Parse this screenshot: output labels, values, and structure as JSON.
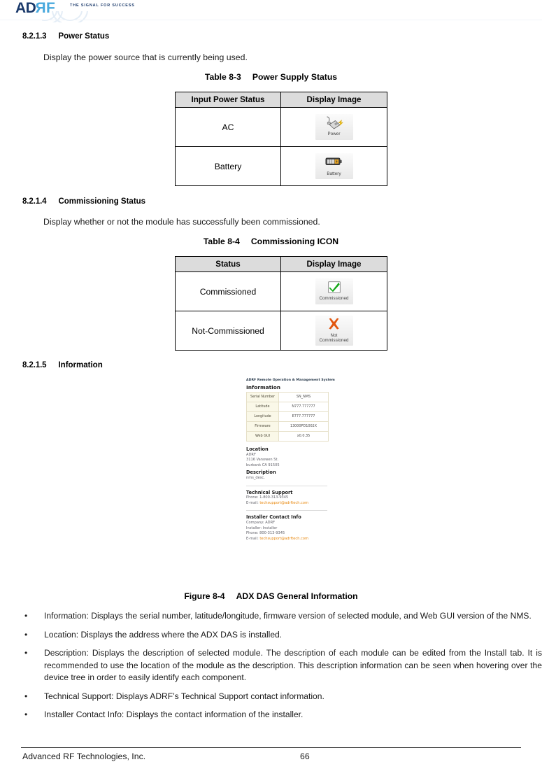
{
  "header": {
    "logo_ad": "AD",
    "logo_r": "R",
    "logo_f": "F",
    "tagline": "THE SIGNAL FOR SUCCESS",
    "brand_navy": "#1b3a6b",
    "brand_cyan": "#49a9dd"
  },
  "sections": [
    {
      "number": "8.2.1.3",
      "title": "Power Status"
    },
    {
      "number": "8.2.1.4",
      "title": "Commissioning Status"
    },
    {
      "number": "8.2.1.5",
      "title": "Information"
    }
  ],
  "paragraphs": {
    "power_status": "Display the power source that is currently being used.",
    "commissioning_status": "Display whether or not the module has successfully been commissioned."
  },
  "table_8_3": {
    "caption_number": "Table 8-3",
    "caption_title": "Power Supply Status",
    "headers": [
      "Input Power Status",
      "Display Image"
    ],
    "rows": [
      {
        "status": "AC",
        "icon_name": "power-plug-icon",
        "icon_caption": "Power"
      },
      {
        "status": "Battery",
        "icon_name": "battery-icon",
        "icon_caption": "Battery"
      }
    ]
  },
  "table_8_4": {
    "caption_number": "Table 8-4",
    "caption_title": "Commissioning ICON",
    "headers": [
      "Status",
      "Display Image"
    ],
    "rows": [
      {
        "status": "Commissioned",
        "icon_name": "green-check-icon",
        "icon_caption": "Commissioned"
      },
      {
        "status": "Not-Commissioned",
        "icon_name": "orange-x-icon",
        "icon_caption_line1": "Not",
        "icon_caption_line2": "Commissioned"
      }
    ]
  },
  "figure": {
    "caption_number": "Figure 8-4",
    "caption_title": "ADX DAS General Information",
    "app_title": "ADRF Remote Operation & Management System",
    "information_heading": "Information",
    "info_rows": [
      {
        "key": "Serial Number",
        "value": "SN_NMS"
      },
      {
        "key": "Latitude",
        "value": "N777.777777"
      },
      {
        "key": "Longitude",
        "value": "E777.777777"
      },
      {
        "key": "Firmware",
        "value": "13000PD1002X"
      },
      {
        "key": "Web GUI",
        "value": "x0.0.35"
      }
    ],
    "location": {
      "heading": "Location",
      "lines": [
        "ADRF",
        "3116 Vanowen St.",
        "burbank CA 91505"
      ]
    },
    "description": {
      "heading": "Description",
      "lines": [
        "nms_desc."
      ]
    },
    "technical_support": {
      "heading": "Technical Support",
      "phone_label": "Phone: 1-800-313-9345",
      "email_label": "E-mail: ",
      "email_value": "techsupport@adrftech.com"
    },
    "installer_contact": {
      "heading": "Installer Contact Info",
      "company": "Company: ADRF",
      "installer": "Installer: Installer",
      "phone": "Phone: 800-313-9345",
      "email_label": "E-mail: ",
      "email_value": "techsupport@adrftech.com"
    },
    "link_color": "#e8860a"
  },
  "bullets": [
    "Information: Displays the serial number, latitude/longitude, firmware version of selected module, and Web GUI version of the NMS.",
    "Location: Displays the address where the ADX DAS is installed.",
    "Description: Displays the description of selected module.  The description of each module can be edited from the Install tab.  It is recommended to use the location of the module as the description.  This description information can be seen when hovering over the device tree in order to easily identify each component.",
    "Technical Support: Displays ADRF’s Technical Support contact information.",
    "Installer Contact Info: Displays the contact information of the installer."
  ],
  "bullet_marker": "•",
  "footer": {
    "company": "Advanced RF Technologies, Inc.",
    "page_number": "66"
  }
}
